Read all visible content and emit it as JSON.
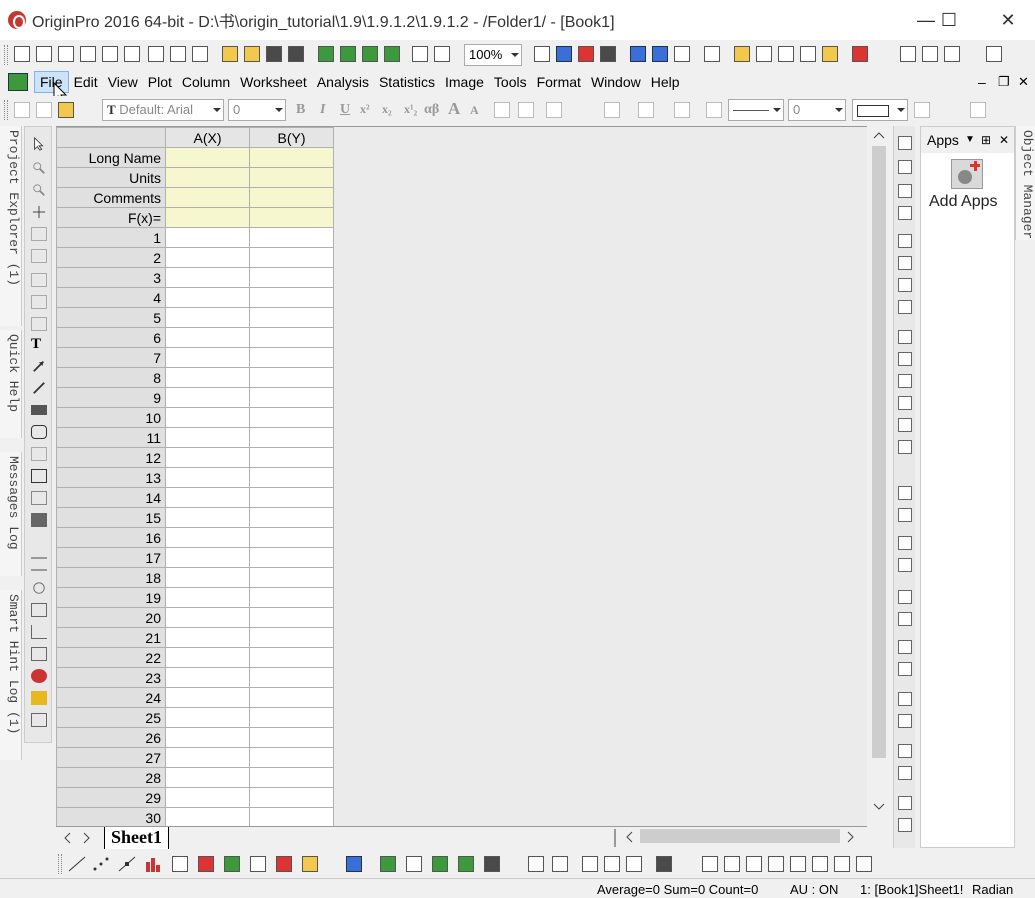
{
  "window": {
    "title": "OriginPro 2016 64-bit - D:\\书\\origin_tutorial\\1.9\\1.9.1.2\\1.9.1.2 - /Folder1/ - [Book1]",
    "minimize": "—",
    "maximize": "☐",
    "close": "✕"
  },
  "toolbar": {
    "zoom": "100%"
  },
  "menu": {
    "items": [
      "File",
      "Edit",
      "View",
      "Plot",
      "Column",
      "Worksheet",
      "Analysis",
      "Statistics",
      "Image",
      "Tools",
      "Format",
      "Window",
      "Help"
    ],
    "active": "File",
    "mdi_min": "–",
    "mdi_restore": "❐",
    "mdi_close": "✕"
  },
  "format_toolbar": {
    "font": "Default: Arial",
    "font_size": "0",
    "bold": "B",
    "italic": "I",
    "underline": "U",
    "superscript": "x²",
    "subscript": "x₂",
    "supsub": "x¹₂",
    "greek": "αβ",
    "grow_font": "A",
    "shrink_font": "A",
    "line_width": "0"
  },
  "side_tabs": {
    "project_explorer": "Project Explorer (1)",
    "quick_help": "Quick Help",
    "messages_log": "Messages Log",
    "smart_hint_log": "Smart Hint Log (1)",
    "object_manager": "Object Manager"
  },
  "worksheet": {
    "columns": [
      "A(X)",
      "B(Y)"
    ],
    "meta_rows": [
      "Long Name",
      "Units",
      "Comments",
      "F(x)="
    ],
    "row_numbers": [
      "1",
      "2",
      "3",
      "4",
      "5",
      "6",
      "7",
      "8",
      "9",
      "10",
      "11",
      "12",
      "13",
      "14",
      "15",
      "16",
      "17",
      "18",
      "19",
      "20",
      "21",
      "22",
      "23",
      "24",
      "25",
      "26",
      "27",
      "28",
      "29",
      "30"
    ],
    "sheet_tab": "Sheet1"
  },
  "apps_panel": {
    "title": "Apps",
    "pin": "⊞",
    "close": "✕",
    "add_apps": "Add Apps"
  },
  "statusbar": {
    "summary": "Average=0 Sum=0 Count=0",
    "au": "AU : ON",
    "location": "1: [Book1]Sheet1!",
    "angle": "Radian"
  }
}
